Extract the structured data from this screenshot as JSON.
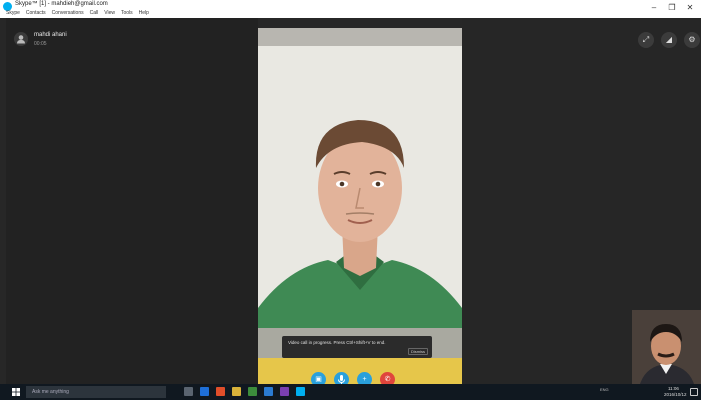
{
  "window": {
    "title": "Skype™ [1] - mahdieh@gmail.com",
    "menu": [
      "Skype",
      "Contacts",
      "Conversations",
      "Call",
      "View",
      "Tools",
      "Help"
    ],
    "controls": [
      "–",
      "❐",
      "✕"
    ]
  },
  "call": {
    "contact_name": "mahdi ahani",
    "status": "00:05",
    "top_buttons": [
      "expand-icon",
      "signal-icon",
      "settings-icon"
    ],
    "notice_text": "Video call in progress. Press Ctrl+Shift+V to end.",
    "notice_button": "Dismiss",
    "controls": [
      {
        "name": "video-button",
        "glyph": "▣"
      },
      {
        "name": "mute-button",
        "glyph": "🎤"
      },
      {
        "name": "add-button",
        "glyph": "+"
      },
      {
        "name": "end-call-button",
        "glyph": "✆"
      }
    ]
  },
  "taskbar": {
    "search_placeholder": "Ask me anything",
    "tray_text": "ENG",
    "time": "11:06",
    "date": "2016/10/12"
  },
  "colors": {
    "accent": "#2aa0dc",
    "end_call": "#e0453c",
    "taskbar": "#101820"
  }
}
